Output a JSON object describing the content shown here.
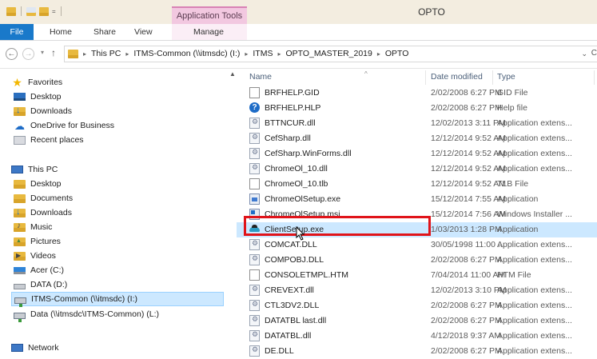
{
  "titlebar": {
    "context_tab": "Application Tools",
    "window_title": "OPTO"
  },
  "ribbon": {
    "tabs": [
      "File",
      "Home",
      "Share",
      "View",
      "Manage"
    ],
    "accent": "#1979ca",
    "context_color": "#f2c8e0"
  },
  "address": {
    "crumbs": [
      "This PC",
      "ITMS-Common (\\\\itmsdc) (I:)",
      "ITMS",
      "OPTO_MASTER_2019",
      "OPTO"
    ],
    "right_char": "C"
  },
  "nav": {
    "favorites_label": "Favorites",
    "favorites": [
      {
        "label": "Desktop",
        "icon": "desktop-icon"
      },
      {
        "label": "Downloads",
        "icon": "downloads-folder-icon"
      },
      {
        "label": "OneDrive for Business",
        "icon": "onedrive-icon"
      },
      {
        "label": "Recent places",
        "icon": "recent-places-icon"
      }
    ],
    "thispc_label": "This PC",
    "thispc": [
      {
        "label": "Desktop",
        "icon": "folder-icon"
      },
      {
        "label": "Documents",
        "icon": "folder-icon"
      },
      {
        "label": "Downloads",
        "icon": "downloads-folder-icon"
      },
      {
        "label": "Music",
        "icon": "music-folder-icon"
      },
      {
        "label": "Pictures",
        "icon": "pictures-folder-icon"
      },
      {
        "label": "Videos",
        "icon": "videos-folder-icon"
      },
      {
        "label": "Acer (C:)",
        "icon": "windows-drive-icon"
      },
      {
        "label": "DATA (D:)",
        "icon": "drive-icon"
      },
      {
        "label": "ITMS-Common (\\\\itmsdc) (I:)",
        "icon": "network-drive-icon",
        "selected": true
      },
      {
        "label": "Data (\\\\itmsdc\\ITMS-Common) (L:)",
        "icon": "network-drive-icon"
      }
    ],
    "network_label": "Network"
  },
  "columns": {
    "name": "Name",
    "date": "Date modified",
    "type": "Type"
  },
  "files": [
    {
      "name": "BRFHELP.GID",
      "date": "2/02/2008 6:27 PM",
      "type": "GID File",
      "icon": "doc"
    },
    {
      "name": "BRFHELP.HLP",
      "date": "2/02/2008 6:27 PM",
      "type": "Help file",
      "icon": "help"
    },
    {
      "name": "BTTNCUR.dll",
      "date": "12/02/2013 3:11 PM",
      "type": "Application extens...",
      "icon": "dll"
    },
    {
      "name": "CefSharp.dll",
      "date": "12/12/2014 9:52 AM",
      "type": "Application extens...",
      "icon": "dll"
    },
    {
      "name": "CefSharp.WinForms.dll",
      "date": "12/12/2014 9:52 AM",
      "type": "Application extens...",
      "icon": "dll"
    },
    {
      "name": "ChromeOl_10.dll",
      "date": "12/12/2014 9:52 AM",
      "type": "Application extens...",
      "icon": "dll"
    },
    {
      "name": "ChromeOl_10.tlb",
      "date": "12/12/2014 9:52 AM",
      "type": "TLB File",
      "icon": "doc"
    },
    {
      "name": "ChromeOlSetup.exe",
      "date": "15/12/2014 7:55 AM",
      "type": "Application",
      "icon": "exe"
    },
    {
      "name": "ChromeOlSetup.msi",
      "date": "15/12/2014 7:56 AM",
      "type": "Windows Installer ...",
      "icon": "msi"
    },
    {
      "name": "ClientSetup.exe",
      "date": "1/03/2013 1:28 PM",
      "type": "Application",
      "icon": "client",
      "selected": true
    },
    {
      "name": "COMCAT.DLL",
      "date": "30/05/1998 11:00 ...",
      "type": "Application extens...",
      "icon": "dll"
    },
    {
      "name": "COMPOBJ.DLL",
      "date": "2/02/2008 6:27 PM",
      "type": "Application extens...",
      "icon": "dll"
    },
    {
      "name": "CONSOLETMPL.HTM",
      "date": "7/04/2014 11:00 AM",
      "type": "HTM File",
      "icon": "doc"
    },
    {
      "name": "CREVEXT.dll",
      "date": "12/02/2013 3:10 PM",
      "type": "Application extens...",
      "icon": "dll"
    },
    {
      "name": "CTL3DV2.DLL",
      "date": "2/02/2008 6:27 PM",
      "type": "Application extens...",
      "icon": "dll"
    },
    {
      "name": "DATATBL last.dll",
      "date": "2/02/2008 6:27 PM",
      "type": "Application extens...",
      "icon": "dll"
    },
    {
      "name": "DATATBL.dll",
      "date": "4/12/2018 9:37 AM",
      "type": "Application extens...",
      "icon": "dll"
    },
    {
      "name": "DE.DLL",
      "date": "2/02/2008 6:27 PM",
      "type": "Application extens...",
      "icon": "dll"
    }
  ],
  "highlight_color": "#e0141a"
}
